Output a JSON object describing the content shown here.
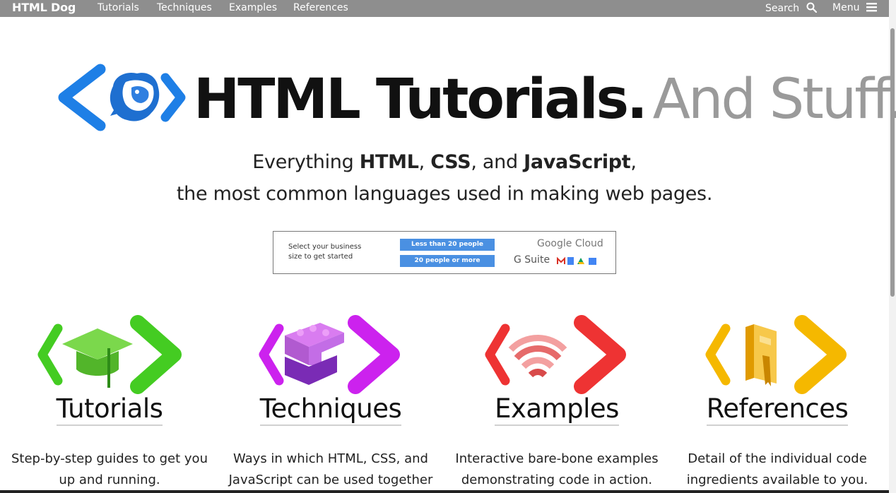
{
  "nav": {
    "brand": "HTML Dog",
    "links": [
      "Tutorials",
      "Techniques",
      "Examples",
      "References"
    ],
    "search_label": "Search",
    "menu_label": "Menu"
  },
  "hero": {
    "title_strong": "HTML Tutorials.",
    "title_light": "And Stuff.",
    "tagline_pre": "Everything ",
    "tagline_html": "HTML",
    "tagline_sep1": ", ",
    "tagline_css": "CSS",
    "tagline_sep2": ", and ",
    "tagline_js": "JavaScript",
    "tagline_end": ",",
    "tagline_line2": "the most common languages used in making web pages."
  },
  "ad": {
    "text_line1": "Select your business",
    "text_line2": "size to get started",
    "button1": "Less than 20 people",
    "button2": "20 people or more",
    "brand1": "Google Cloud",
    "brand2": "G Suite"
  },
  "cards": [
    {
      "title": "Tutorials",
      "desc_line1": "Step-by-step guides to get you",
      "desc_line2": "up and running.",
      "color": "#44cc22",
      "icon": "graduation-cap-icon"
    },
    {
      "title": "Techniques",
      "desc_line1": "Ways in which HTML, CSS, and",
      "desc_line2": "JavaScript can be used together",
      "color": "#cc22ee",
      "icon": "building-blocks-icon"
    },
    {
      "title": "Examples",
      "desc_line1": "Interactive bare-bone examples",
      "desc_line2": "demonstrating code in action.",
      "color": "#ee3333",
      "icon": "wifi-blocks-icon"
    },
    {
      "title": "References",
      "desc_line1": "Detail of the individual code",
      "desc_line2": "ingredients available to you.",
      "color": "#f5b800",
      "icon": "book-icon"
    }
  ]
}
